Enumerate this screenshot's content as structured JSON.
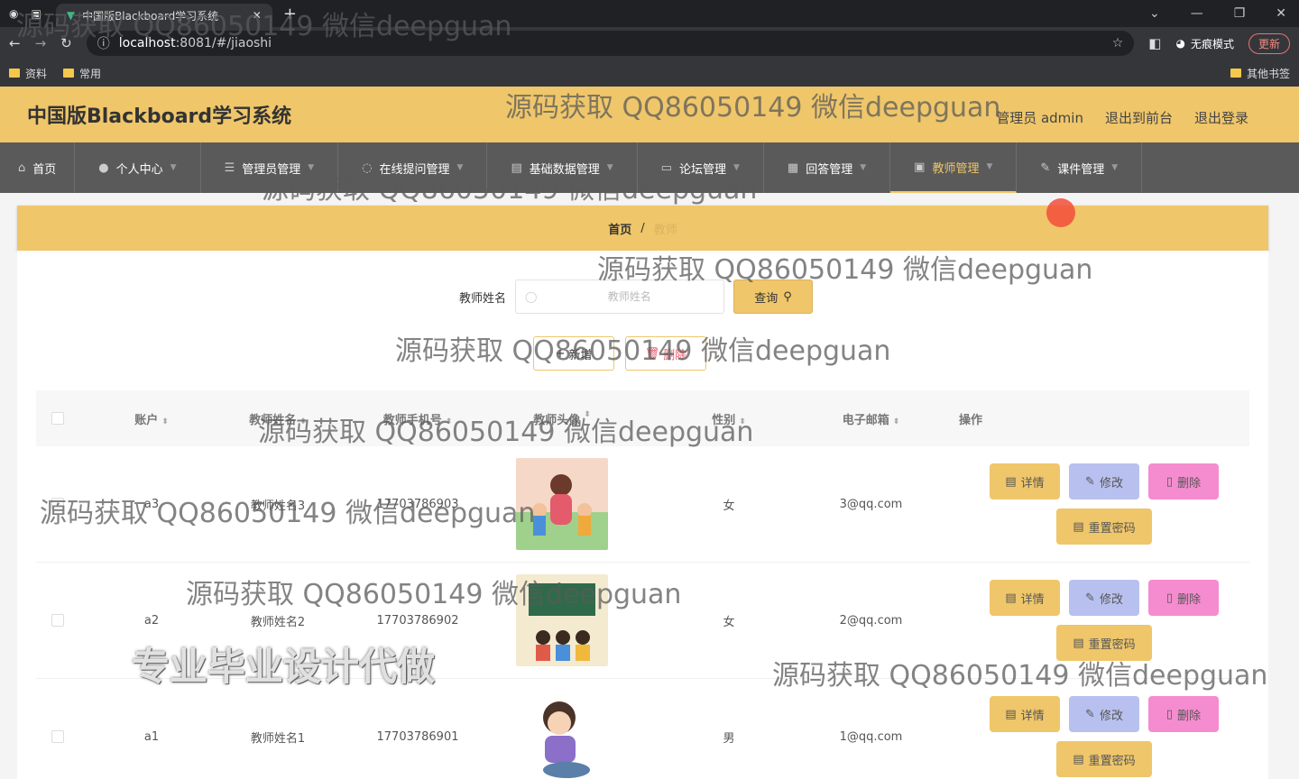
{
  "browser": {
    "tab_title": "中国版Blackboard学习系统",
    "url_host": "localhost",
    "url_path": ":8081/#/jiaoshi",
    "incognito_label": "无痕模式",
    "update_label": "更新",
    "bookmarks": [
      "资料",
      "常用"
    ],
    "other_bookmarks": "其他书签"
  },
  "header": {
    "title": "中国版Blackboard学习系统",
    "user": "管理员 admin",
    "back_to_front": "退出到前台",
    "logout": "退出登录"
  },
  "nav": [
    {
      "label": "首页",
      "icon": "home-icon"
    },
    {
      "label": "个人中心",
      "icon": "user-icon"
    },
    {
      "label": "管理员管理",
      "icon": "list-icon"
    },
    {
      "label": "在线提问管理",
      "icon": "chat-icon"
    },
    {
      "label": "基础数据管理",
      "icon": "folder-icon"
    },
    {
      "label": "论坛管理",
      "icon": "forum-icon"
    },
    {
      "label": "回答管理",
      "icon": "grid-icon"
    },
    {
      "label": "教师管理",
      "icon": "doc-icon"
    },
    {
      "label": "课件管理",
      "icon": "edit-icon"
    }
  ],
  "breadcrumb": {
    "home": "首页",
    "sep": "/",
    "current": "教师"
  },
  "search": {
    "label": "教师姓名",
    "placeholder": "教师姓名",
    "button": "查询"
  },
  "actions": {
    "add": "新增",
    "delete": "删除"
  },
  "table": {
    "headers": {
      "account": "账户",
      "name": "教师姓名",
      "phone": "教师手机号",
      "avatar": "教师头像",
      "gender": "性别",
      "email": "电子邮箱",
      "ops": "操作"
    },
    "rows": [
      {
        "account": "a3",
        "name": "教师姓名3",
        "phone": "17703786903",
        "gender": "女",
        "email": "3@qq.com"
      },
      {
        "account": "a2",
        "name": "教师姓名2",
        "phone": "17703786902",
        "gender": "女",
        "email": "2@qq.com"
      },
      {
        "account": "a1",
        "name": "教师姓名1",
        "phone": "17703786901",
        "gender": "男",
        "email": "1@qq.com"
      }
    ],
    "op_labels": {
      "detail": "详情",
      "edit": "修改",
      "del": "删除",
      "reset": "重置密码"
    }
  },
  "watermark": "源码获取 QQ86050149 微信deepguan",
  "watermark_big": "专业毕业设计代做"
}
